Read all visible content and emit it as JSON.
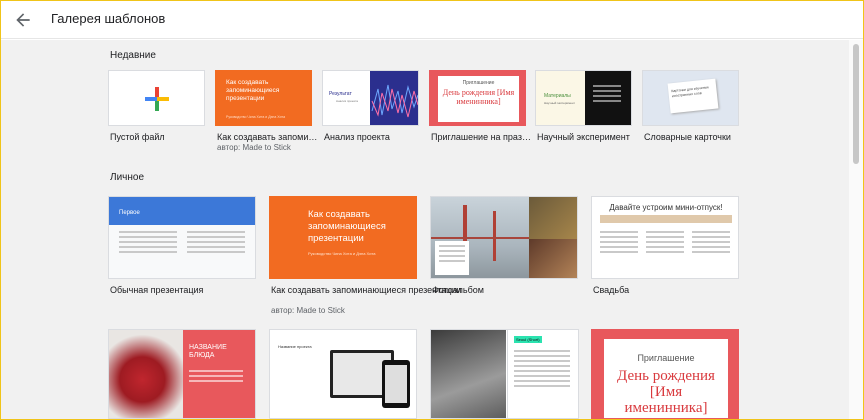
{
  "header": {
    "title": "Галерея шаблонов"
  },
  "sections": {
    "recent": "Недавние",
    "personal": "Личное"
  },
  "recent": [
    {
      "label": "Пустой файл"
    },
    {
      "label": "Как создавать запоми…",
      "sub": "автор: Made to Stick",
      "thumb_title": "Как создавать запоминающиеся презентации",
      "thumb_caption": "Руководство Чипа Хита и Дэна Хита"
    },
    {
      "label": "Анализ проекта",
      "thumb_title": "Результат",
      "thumb_sub": "Анализ проекта"
    },
    {
      "label": "Приглашение на праз…",
      "thumb_small": "Приглашение",
      "thumb_big": "День рождения [Имя именинника]"
    },
    {
      "label": "Научный эксперимент",
      "thumb_title": "Материалы",
      "thumb_sub": "Научный эксперимент"
    },
    {
      "label": "Словарные карточки",
      "thumb_title": "Карточки для изучения иностранных слов"
    }
  ],
  "personal": [
    {
      "label": "Обычная презентация",
      "thumb_title": "Первое"
    },
    {
      "label": "Как создавать запоминающиеся презентации",
      "sub": "автор: Made to Stick",
      "thumb_title": "Как создавать запоминающиеся презентации",
      "thumb_caption": "Руководство Чипа Хита и Дэна Хита"
    },
    {
      "label": "Фотоальбом"
    },
    {
      "label": "Свадьба",
      "thumb_title": "Давайте устроим мини-отпуск!"
    }
  ],
  "bottom": [
    {
      "thumb_title": "НАЗВАНИЕ БЛЮДА"
    },
    {
      "thumb_title": "Название проекта"
    },
    {},
    {
      "thumb_title": "Seoul (Short)"
    },
    {
      "thumb_small": "Приглашение",
      "thumb_big": "День рождения [Имя именинника]"
    }
  ],
  "colors": {
    "accent_orange": "#f26b21",
    "blue": "#3c78d8",
    "navy": "#2b2f8e",
    "pink": "#e8585c",
    "frame": "#f0c419"
  }
}
